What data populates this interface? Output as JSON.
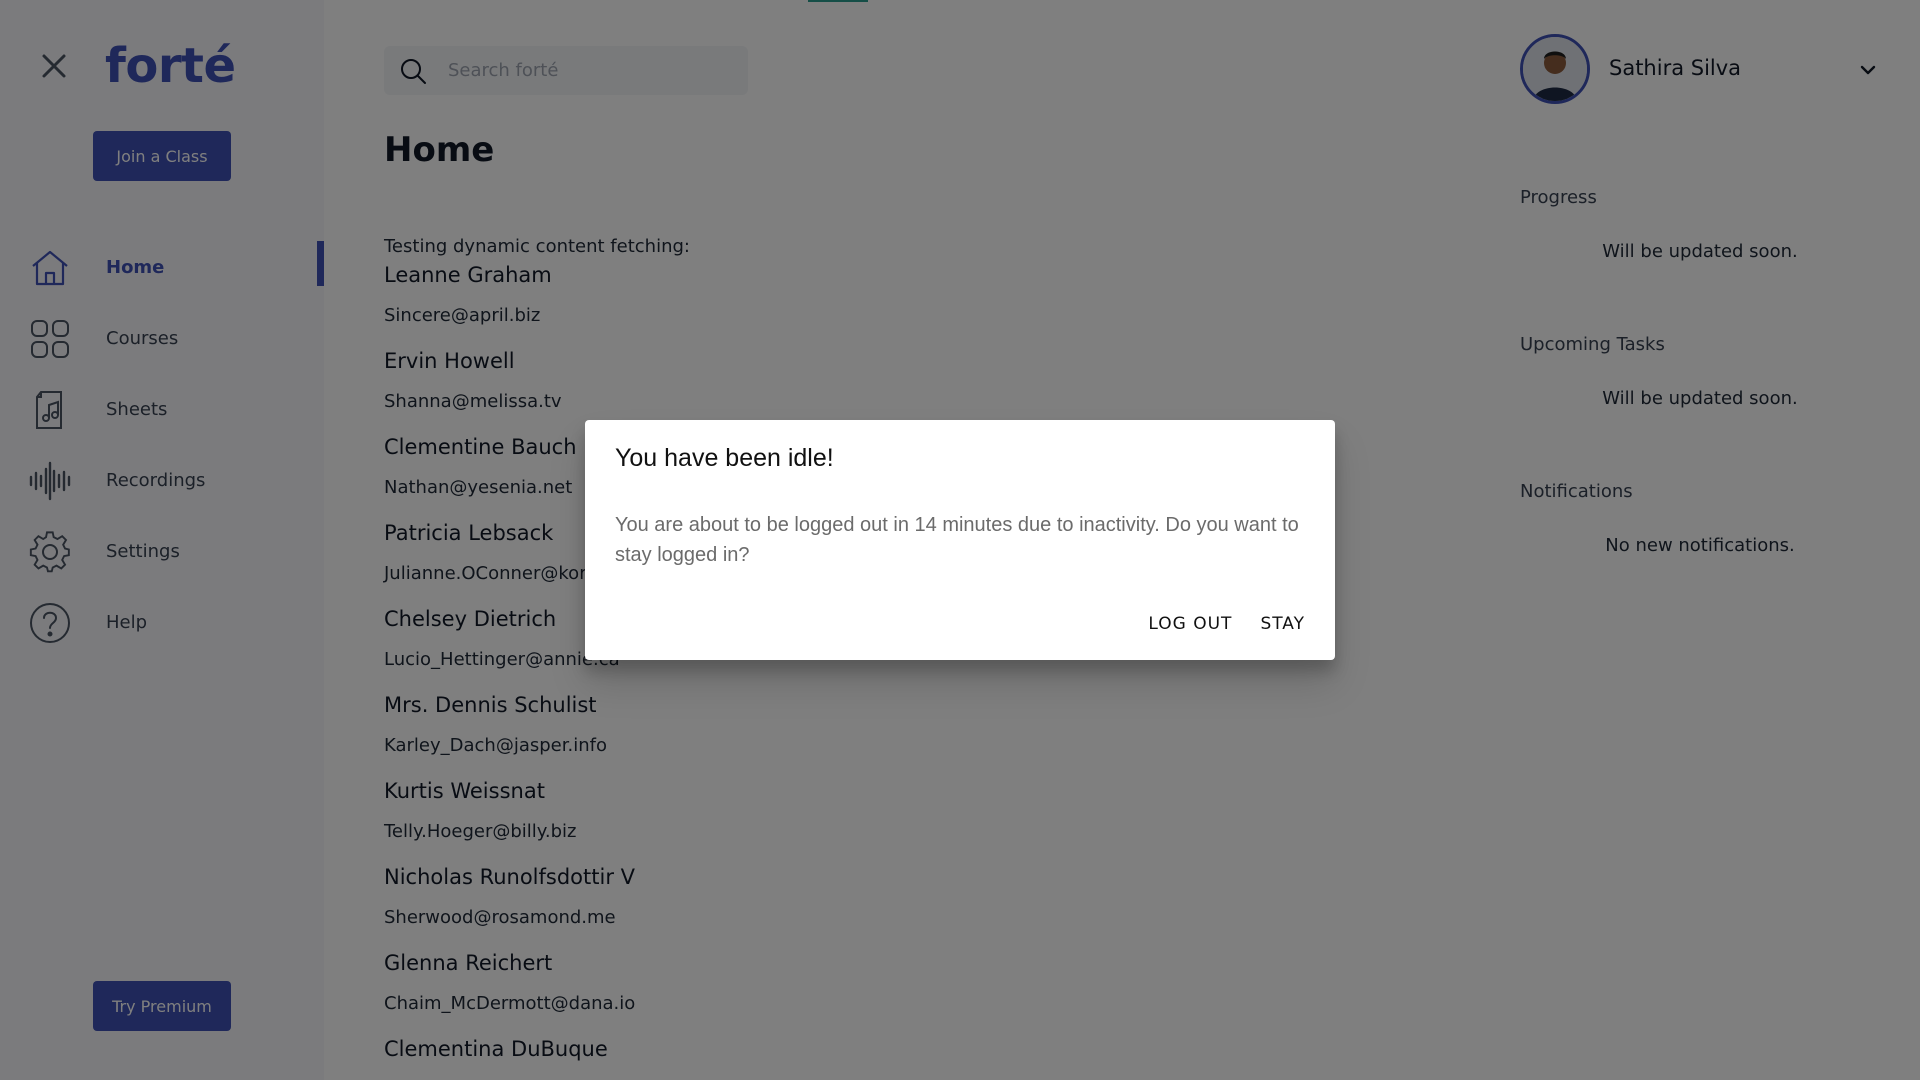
{
  "app": {
    "logo": "forté"
  },
  "sidebar": {
    "join_button": "Join a Class",
    "premium_button": "Try Premium",
    "items": [
      {
        "label": "Home",
        "icon": "home-icon",
        "active": true
      },
      {
        "label": "Courses",
        "icon": "grid-icon",
        "active": false
      },
      {
        "label": "Sheets",
        "icon": "music-sheet-icon",
        "active": false
      },
      {
        "label": "Recordings",
        "icon": "waveform-icon",
        "active": false
      },
      {
        "label": "Settings",
        "icon": "gear-icon",
        "active": false
      },
      {
        "label": "Help",
        "icon": "help-icon",
        "active": false
      }
    ]
  },
  "search": {
    "placeholder": "Search forté"
  },
  "main": {
    "title": "Home",
    "intro": "Testing dynamic content fetching:",
    "users": [
      {
        "name": "Leanne Graham",
        "email": "Sincere@april.biz"
      },
      {
        "name": "Ervin Howell",
        "email": "Shanna@melissa.tv"
      },
      {
        "name": "Clementine Bauch",
        "email": "Nathan@yesenia.net"
      },
      {
        "name": "Patricia Lebsack",
        "email": "Julianne.OConner@kory.org"
      },
      {
        "name": "Chelsey Dietrich",
        "email": "Lucio_Hettinger@annie.ca"
      },
      {
        "name": "Mrs. Dennis Schulist",
        "email": "Karley_Dach@jasper.info"
      },
      {
        "name": "Kurtis Weissnat",
        "email": "Telly.Hoeger@billy.biz"
      },
      {
        "name": "Nicholas Runolfsdottir V",
        "email": "Sherwood@rosamond.me"
      },
      {
        "name": "Glenna Reichert",
        "email": "Chaim_McDermott@dana.io"
      },
      {
        "name": "Clementina DuBuque",
        "email": ""
      }
    ]
  },
  "profile": {
    "name": "Sathira Silva"
  },
  "panel": {
    "progress_title": "Progress",
    "progress_text": "Will be updated soon.",
    "tasks_title": "Upcoming Tasks",
    "tasks_text": "Will be updated soon.",
    "notifications_title": "Notifications",
    "notifications_text": "No new notifications."
  },
  "dialog": {
    "title": "You have been idle!",
    "message": "You are about to be logged out in 14 minutes due to inactivity. Do you want to stay logged in?",
    "logout_label": "LOG OUT",
    "stay_label": "STAY"
  },
  "colors": {
    "brand": "#3f51b5",
    "overlay": "rgba(0,0,0,0.5)",
    "progress": "#2a9d8f"
  }
}
